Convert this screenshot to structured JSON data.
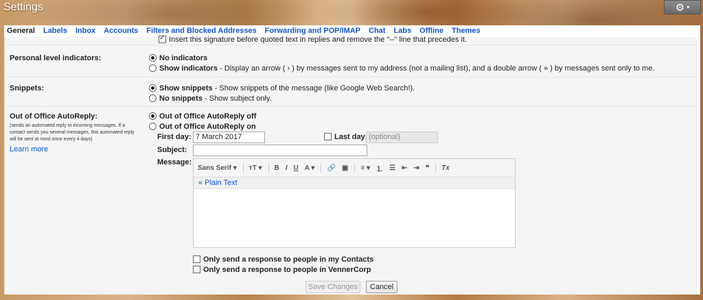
{
  "header": {
    "title": "Settings",
    "gear_icon": "⚙",
    "caret": "▾"
  },
  "tabs": [
    "General",
    "Labels",
    "Inbox",
    "Accounts",
    "Filters and Blocked Addresses",
    "Forwarding and POP/IMAP",
    "Chat",
    "Labs",
    "Offline",
    "Themes"
  ],
  "signature_note": "Insert this signature before quoted text in replies and remove the \"--\" line that precedes it.",
  "personal_level": {
    "label": "Personal level indicators:",
    "opt1": "No indicators",
    "opt2": "Show indicators",
    "opt2_desc": " - Display an arrow ( › ) by messages sent to my address (not a mailing list), and a double arrow ( » ) by messages sent only to me."
  },
  "snippets": {
    "label": "Snippets:",
    "opt1": "Show snippets",
    "opt1_desc": " - Show snippets of the message (like Google Web Search!).",
    "opt2": "No snippets",
    "opt2_desc": " - Show subject only."
  },
  "ooo": {
    "label": "Out of Office AutoReply:",
    "desc": "(sends an automated reply to incoming messages. If a contact sends you several messages, this automated reply will be sent at most once every 4 days)",
    "learn_more": "Learn more",
    "opt_off": "Out of Office AutoReply off",
    "opt_on": "Out of Office AutoReply on",
    "first_day_label": "First day:",
    "first_day_value": "7 March 2017",
    "last_day_label": "Last day:",
    "last_day_placeholder": "(optional)",
    "subject_label": "Subject:",
    "message_label": "Message:",
    "plain_text": "« Plain Text",
    "contacts_only": "Only send a response to people in my Contacts",
    "org_only": "Only send a response to people in VennerCorp"
  },
  "toolbar": {
    "font": "Sans Serif ▾",
    "size": "тT ▾",
    "bold": "B",
    "italic": "I",
    "underline": "U",
    "text_color": "A ▾",
    "link": "🔗",
    "image": "▣",
    "align": "≡ ▾",
    "numbered": "⒈",
    "bulleted": "☰",
    "indent_less": "⇤",
    "indent_more": "⇥",
    "quote": "❝",
    "clear": "Tx"
  },
  "buttons": {
    "save": "Save Changes",
    "cancel": "Cancel"
  }
}
